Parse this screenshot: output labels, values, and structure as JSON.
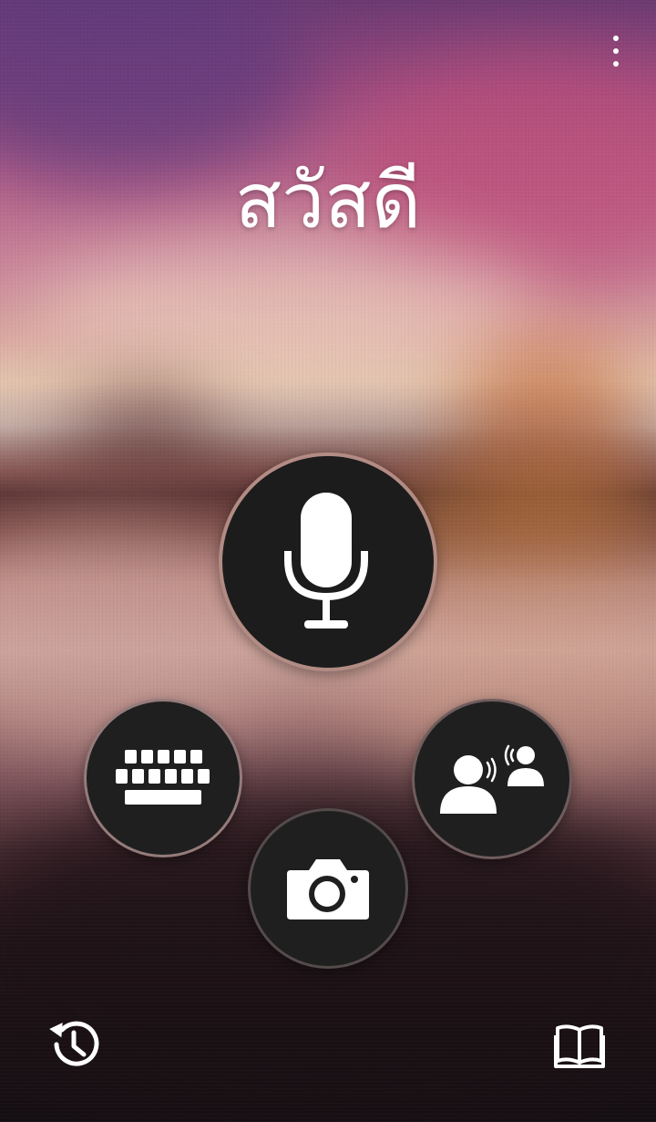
{
  "greeting": {
    "text": "สวัสดี"
  },
  "icons": {
    "menu": "more-vertical-icon",
    "microphone": "microphone-icon",
    "keyboard": "keyboard-icon",
    "camera": "camera-icon",
    "conversation": "conversation-icon",
    "history": "history-icon",
    "phrasebook": "phrasebook-icon"
  },
  "colors": {
    "button_fill": "#1f1f1f",
    "icon": "#ffffff",
    "mic_ring": "#cda096"
  }
}
